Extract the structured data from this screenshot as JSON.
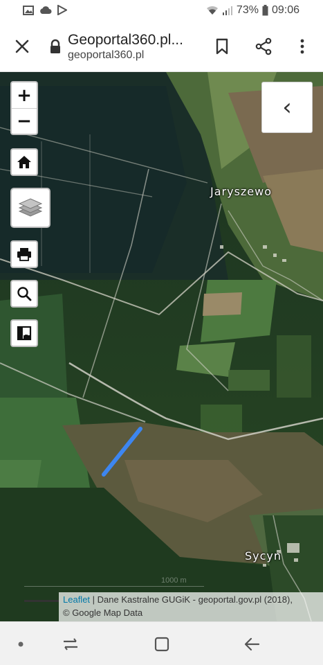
{
  "status_bar": {
    "left_icons": [
      "gallery-icon",
      "cloud-icon",
      "play-store-icon"
    ],
    "battery": "73%",
    "time": "09:06"
  },
  "browser": {
    "page_title": "Geoportal360.pl...",
    "domain": "geoportal360.pl"
  },
  "map": {
    "labels": {
      "jaryszewo": "Jaryszewo",
      "sycyn": "Sycyn"
    },
    "scale_text": "1000 m",
    "attribution": {
      "link": "Leaflet",
      "line1_rest": " | Dane Kastralne GUGiK - geoportal.gov.pl (2018),",
      "line2": "© Google Map Data"
    },
    "controls": {
      "zoom_in": "+",
      "zoom_out": "−",
      "panel_toggle": "‹"
    },
    "line_color": "#3d86f0"
  }
}
